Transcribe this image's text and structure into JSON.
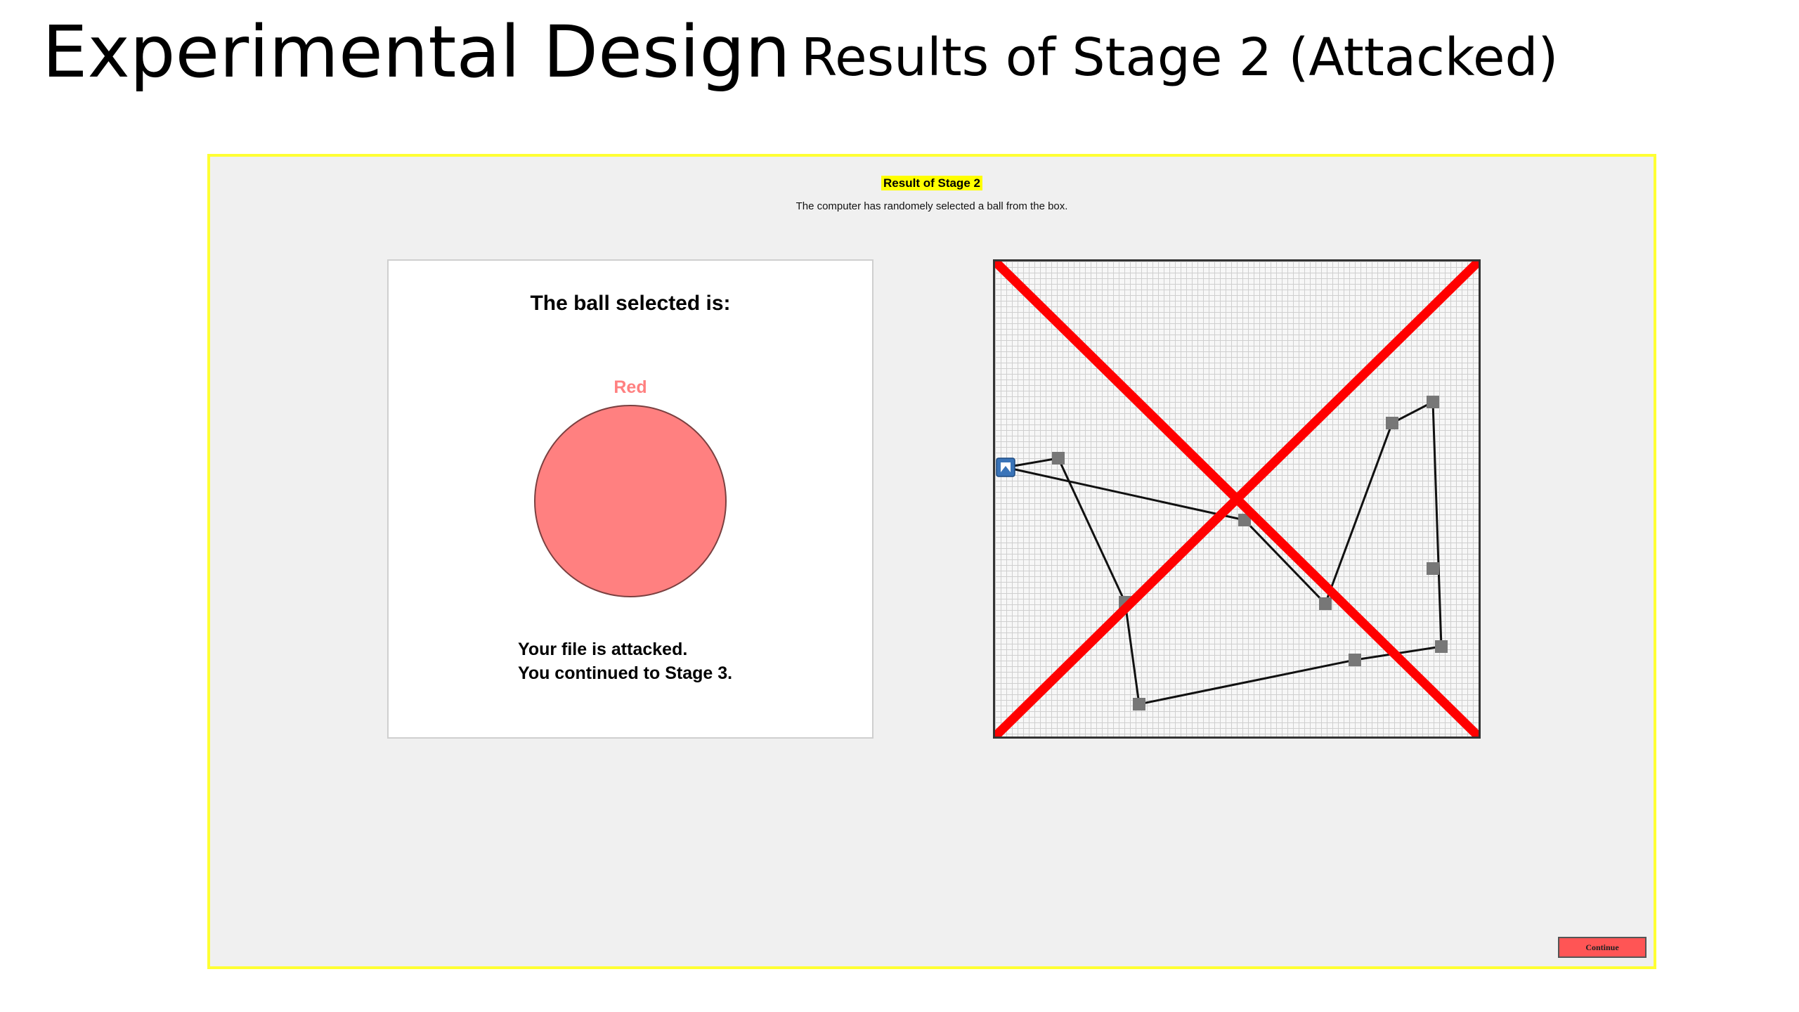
{
  "slide": {
    "title": "Experimental Design",
    "subtitle": "Results of Stage 2 (Attacked)"
  },
  "app": {
    "heading": "Result of Stage 2",
    "description": "The computer has randomely selected a ball from the box.",
    "ball_panel": {
      "heading": "The ball selected is:",
      "ball_color_label": "Red",
      "ball_fill_color": "#ff8080",
      "label_color": "#ff8080",
      "message_line1": "Your file is attacked.",
      "message_line2": "You continued to Stage 3."
    },
    "grid_panel": {
      "path_color": "#111111",
      "node_color": "#777777",
      "cross_color": "#ff0000",
      "start_icon": "file-icon"
    },
    "continue_label": "Continue"
  }
}
